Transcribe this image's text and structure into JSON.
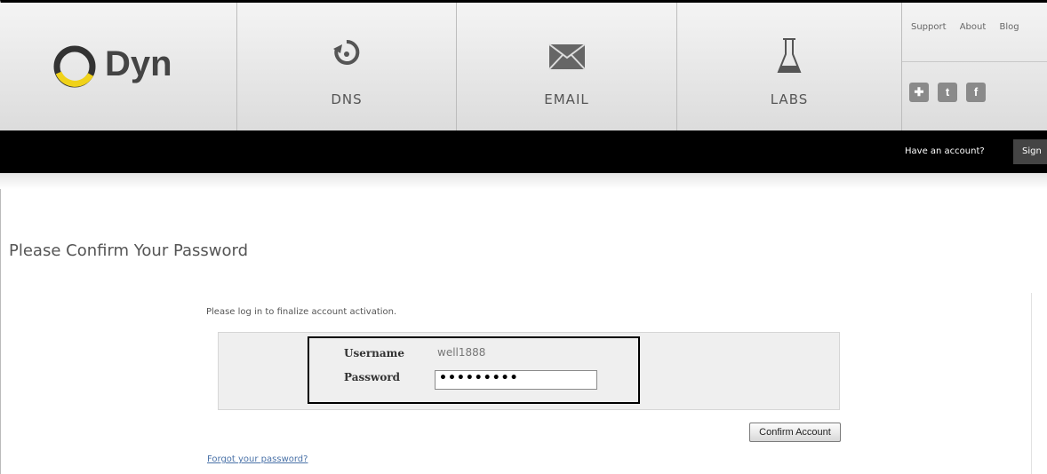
{
  "header": {
    "logo_text": "Dyn",
    "nav": [
      {
        "label": "DNS",
        "icon": "dns-refresh-icon"
      },
      {
        "label": "EMAIL",
        "icon": "envelope-icon"
      },
      {
        "label": "LABS",
        "icon": "flask-icon"
      }
    ],
    "top_links": [
      "Support",
      "About",
      "Blog"
    ],
    "socials": [
      "union-jack-icon",
      "twitter-icon",
      "facebook-icon"
    ]
  },
  "account_bar": {
    "prompt": "Have an account?",
    "signin_label": "Sign"
  },
  "page": {
    "title": "Please Confirm Your Password",
    "instructions": "Please log in to finalize account activation.",
    "username_label": "Username",
    "username_value": "well1888",
    "password_label": "Password",
    "password_value": "•••••••••",
    "confirm_label": "Confirm Account",
    "forgot_label": "Forgot your password?"
  },
  "colors": {
    "header_bg": "#e6e6e6",
    "account_bar_bg": "#000000",
    "logo_accent": "#f0d21a",
    "link": "#4a72a8"
  }
}
